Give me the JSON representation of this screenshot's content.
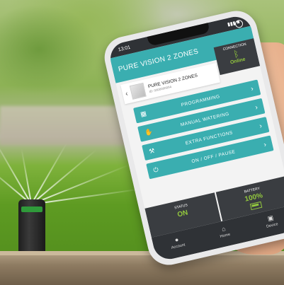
{
  "status_bar": {
    "time": "13:01",
    "signal": "▮▮▮ ■"
  },
  "app": {
    "title": "PURE VISION 2 ZONES"
  },
  "connection": {
    "label": "CONNECTION",
    "state": "Online",
    "icon": "bluetooth-icon"
  },
  "device": {
    "name": "PURE VISION 2 ZONES",
    "id": "ID: 0000000004"
  },
  "menu": [
    {
      "label": "PROGRAMMING",
      "icon": "timer-icon"
    },
    {
      "label": "MANUAL WATERING",
      "icon": "hand-icon"
    },
    {
      "label": "EXTRA FUNCTIONS",
      "icon": "wrench-icon"
    },
    {
      "label": "ON / OFF / PAUSE",
      "icon": "power-icon"
    }
  ],
  "status": {
    "label": "STATUS",
    "value": "ON"
  },
  "battery": {
    "label": "BATTERY",
    "value": "100%",
    "level": 1.0
  },
  "tabs": [
    {
      "label": "Account",
      "icon": "user-icon"
    },
    {
      "label": "Home",
      "icon": "home-icon"
    },
    {
      "label": "Device",
      "icon": "device-icon"
    }
  ],
  "colors": {
    "teal": "#3aaeb0",
    "dark": "#3a3d41",
    "green": "#93c83e"
  }
}
